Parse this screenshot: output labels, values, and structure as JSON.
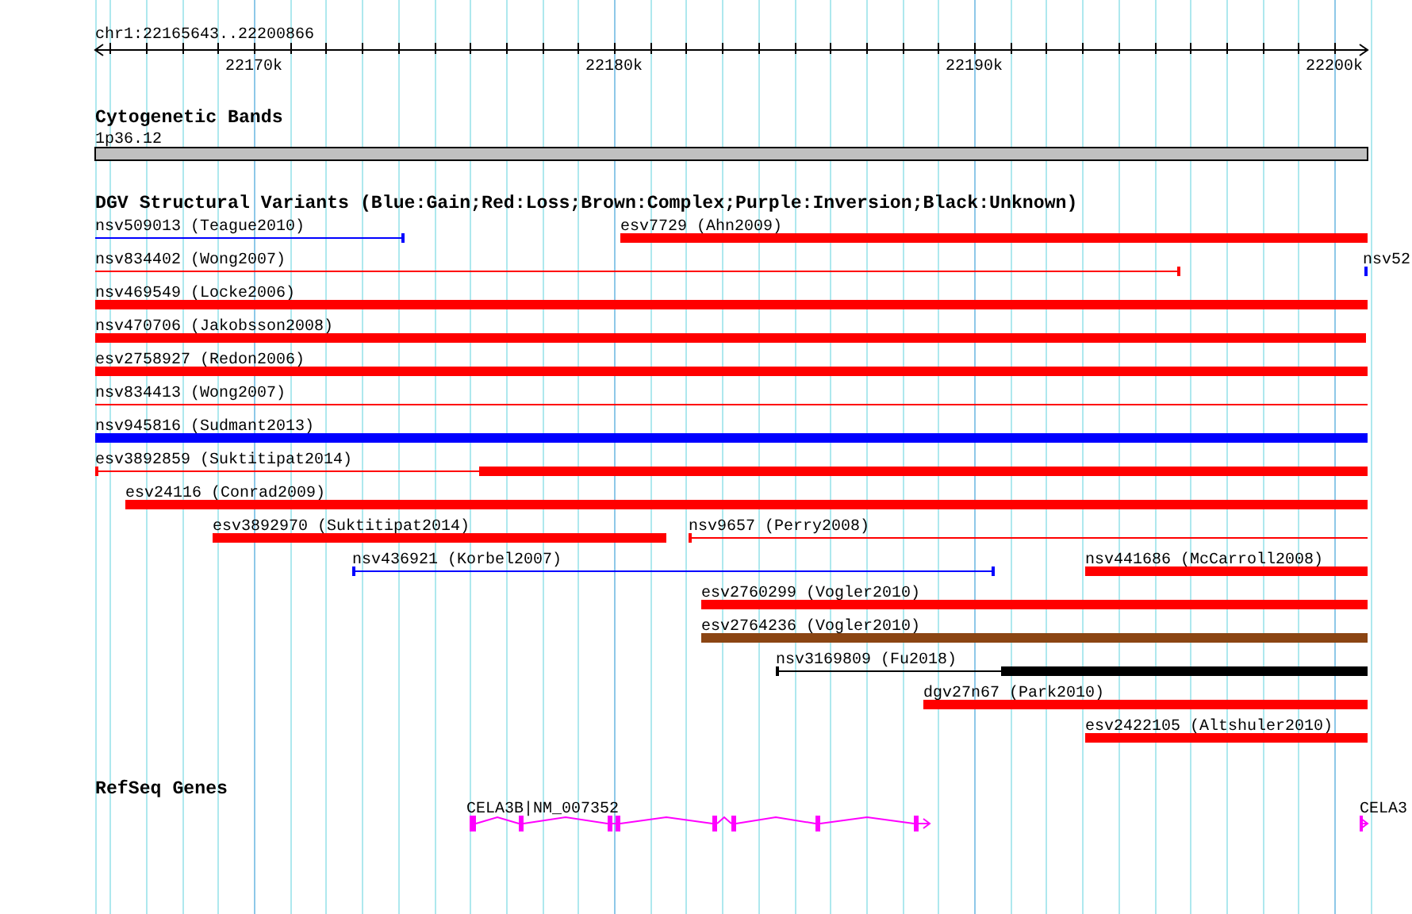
{
  "ruler": {
    "range": "chr1:22165643..22200866",
    "ticks": [
      "22170k",
      "22180k",
      "22190k",
      "22200k"
    ]
  },
  "cytogenetic_bands": {
    "title": "Cytogenetic Bands",
    "band": "1p36.12"
  },
  "dgv": {
    "title": "DGV Structural Variants (Blue:Gain;Red:Loss;Brown:Complex;Purple:Inversion;Black:Unknown)",
    "variants": [
      {
        "label": "nsv509013 (Teague2010)",
        "kind": "thin",
        "color": "#0000ff"
      },
      {
        "label": "esv7729 (Ahn2009)",
        "kind": "thick",
        "color": "#ff0000"
      },
      {
        "label": "nsv834402 (Wong2007)",
        "kind": "thin",
        "color": "#ff0000"
      },
      {
        "label": "nsv52",
        "kind": "thick",
        "color": "#0000ff"
      },
      {
        "label": "nsv469549 (Locke2006)",
        "kind": "thick",
        "color": "#ff0000"
      },
      {
        "label": "nsv470706 (Jakobsson2008)",
        "kind": "thick",
        "color": "#ff0000"
      },
      {
        "label": "esv2758927 (Redon2006)",
        "kind": "thick",
        "color": "#ff0000"
      },
      {
        "label": "nsv834413 (Wong2007)",
        "kind": "thin",
        "color": "#ff0000"
      },
      {
        "label": "nsv945816 (Sudmant2013)",
        "kind": "thick",
        "color": "#0000ff"
      },
      {
        "label": "esv3892859 (Suktitipat2014)",
        "kind": "split",
        "color": "#ff0000"
      },
      {
        "label": "esv24116 (Conrad2009)",
        "kind": "thick",
        "color": "#ff0000"
      },
      {
        "label": "esv3892970 (Suktitipat2014)",
        "kind": "thick",
        "color": "#ff0000"
      },
      {
        "label": "nsv9657 (Perry2008)",
        "kind": "thin",
        "color": "#ff0000"
      },
      {
        "label": "nsv436921 (Korbel2007)",
        "kind": "thin",
        "color": "#0000ff"
      },
      {
        "label": "nsv441686 (McCarroll2008)",
        "kind": "thick",
        "color": "#ff0000"
      },
      {
        "label": "esv2760299 (Vogler2010)",
        "kind": "thick",
        "color": "#ff0000"
      },
      {
        "label": "esv2764236 (Vogler2010)",
        "kind": "thick",
        "color": "#8b4513"
      },
      {
        "label": "nsv3169809 (Fu2018)",
        "kind": "split",
        "color": "#000000"
      },
      {
        "label": "dgv27n67 (Park2010)",
        "kind": "thick",
        "color": "#ff0000"
      },
      {
        "label": "esv2422105 (Altshuler2010)",
        "kind": "thick",
        "color": "#ff0000"
      }
    ]
  },
  "refseq": {
    "title": "RefSeq Genes",
    "genes": [
      {
        "label": "CELA3B|NM_007352"
      },
      {
        "label": "CELA3"
      }
    ]
  }
}
